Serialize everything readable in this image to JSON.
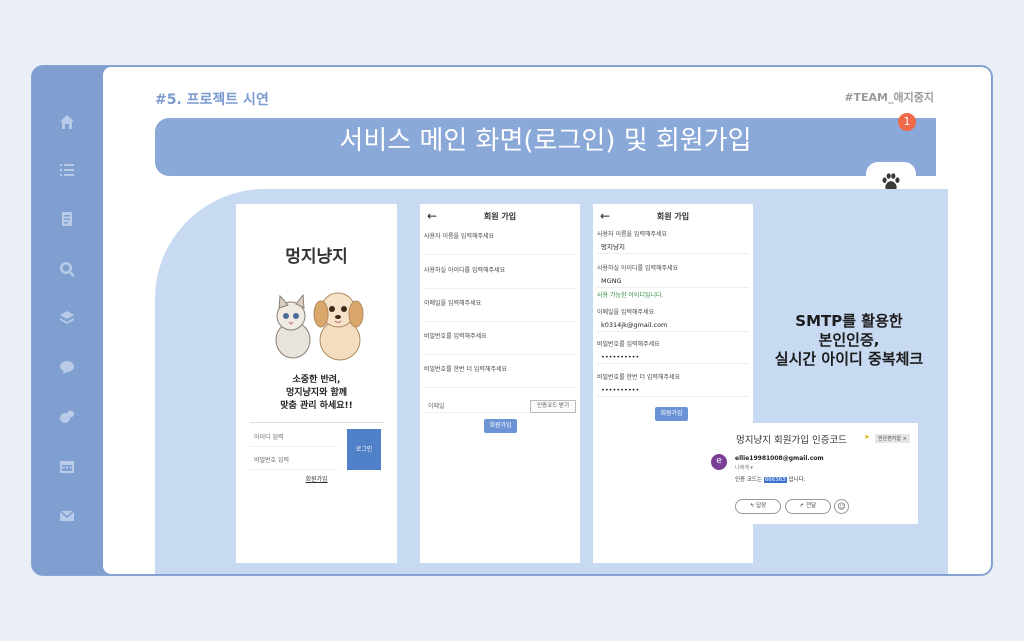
{
  "header": {
    "slide_label": "#5. 프로젝트 시연",
    "team_label": "#TEAM_애지중지",
    "title": "서비스 메인 화면(로그인) 및 회원가입",
    "badge": "1"
  },
  "sidebar": {
    "icons": [
      "home-icon",
      "list-icon",
      "document-icon",
      "search-icon",
      "layers-icon",
      "chat-icon",
      "settings-icon",
      "calendar-icon",
      "mail-icon"
    ]
  },
  "login_screen": {
    "app_title": "멍지냥지",
    "tagline": [
      "소중한 반려,",
      "멍지냥지와 함께",
      "맞춤 관리 하세요!!"
    ],
    "id_placeholder": "아이디 입력",
    "pw_placeholder": "비밀번호 입력",
    "login_button": "로그인",
    "signup_link": "회원가입"
  },
  "signup_empty": {
    "back": "←",
    "header": "회원 가입",
    "fields": [
      "사용자 이름을 입력해주세요",
      "사용하실 아이디를 입력해주세요",
      "이메일을 입력해주세요",
      "비밀번호를 입력해주세요",
      "비밀번호를 한번 더 입력해주세요"
    ],
    "email_placeholder": "이메일",
    "verify_button": "인증코드 받기",
    "submit_button": "회원가입"
  },
  "signup_filled": {
    "back": "←",
    "header": "회원 가입",
    "fields": [
      {
        "label": "사용자 이름을 입력해주세요",
        "value": "멍지냥지"
      },
      {
        "label": "사용하실 아이디를 입력해주세요",
        "value": "MGNG",
        "note": "사용 가능한 아이디입니다."
      },
      {
        "label": "이메일을 입력해주세요",
        "value": "k0314jk@gmail.com"
      },
      {
        "label": "비밀번호를 입력해주세요",
        "value": "••••••••••"
      },
      {
        "label": "비밀번호를 한번 더 입력해주세요",
        "value": "••••••••••"
      }
    ],
    "submit_button": "회원가입"
  },
  "description": [
    "SMTP를 활용한",
    "본인인증,",
    "실시간 아이디 중복체크"
  ],
  "email": {
    "subject": "멍지냥지 회원가입 인증코드",
    "tag": "받은편지함 ×",
    "avatar": "e",
    "from": "ellie19981008@gmail.com",
    "to": "나에게 ▾",
    "body_prefix": "인증 코드는 ",
    "code": "666363",
    "body_suffix": " 입니다.",
    "reply": "↰ 답장",
    "forward": "↱ 전달",
    "emoji": "☺"
  }
}
